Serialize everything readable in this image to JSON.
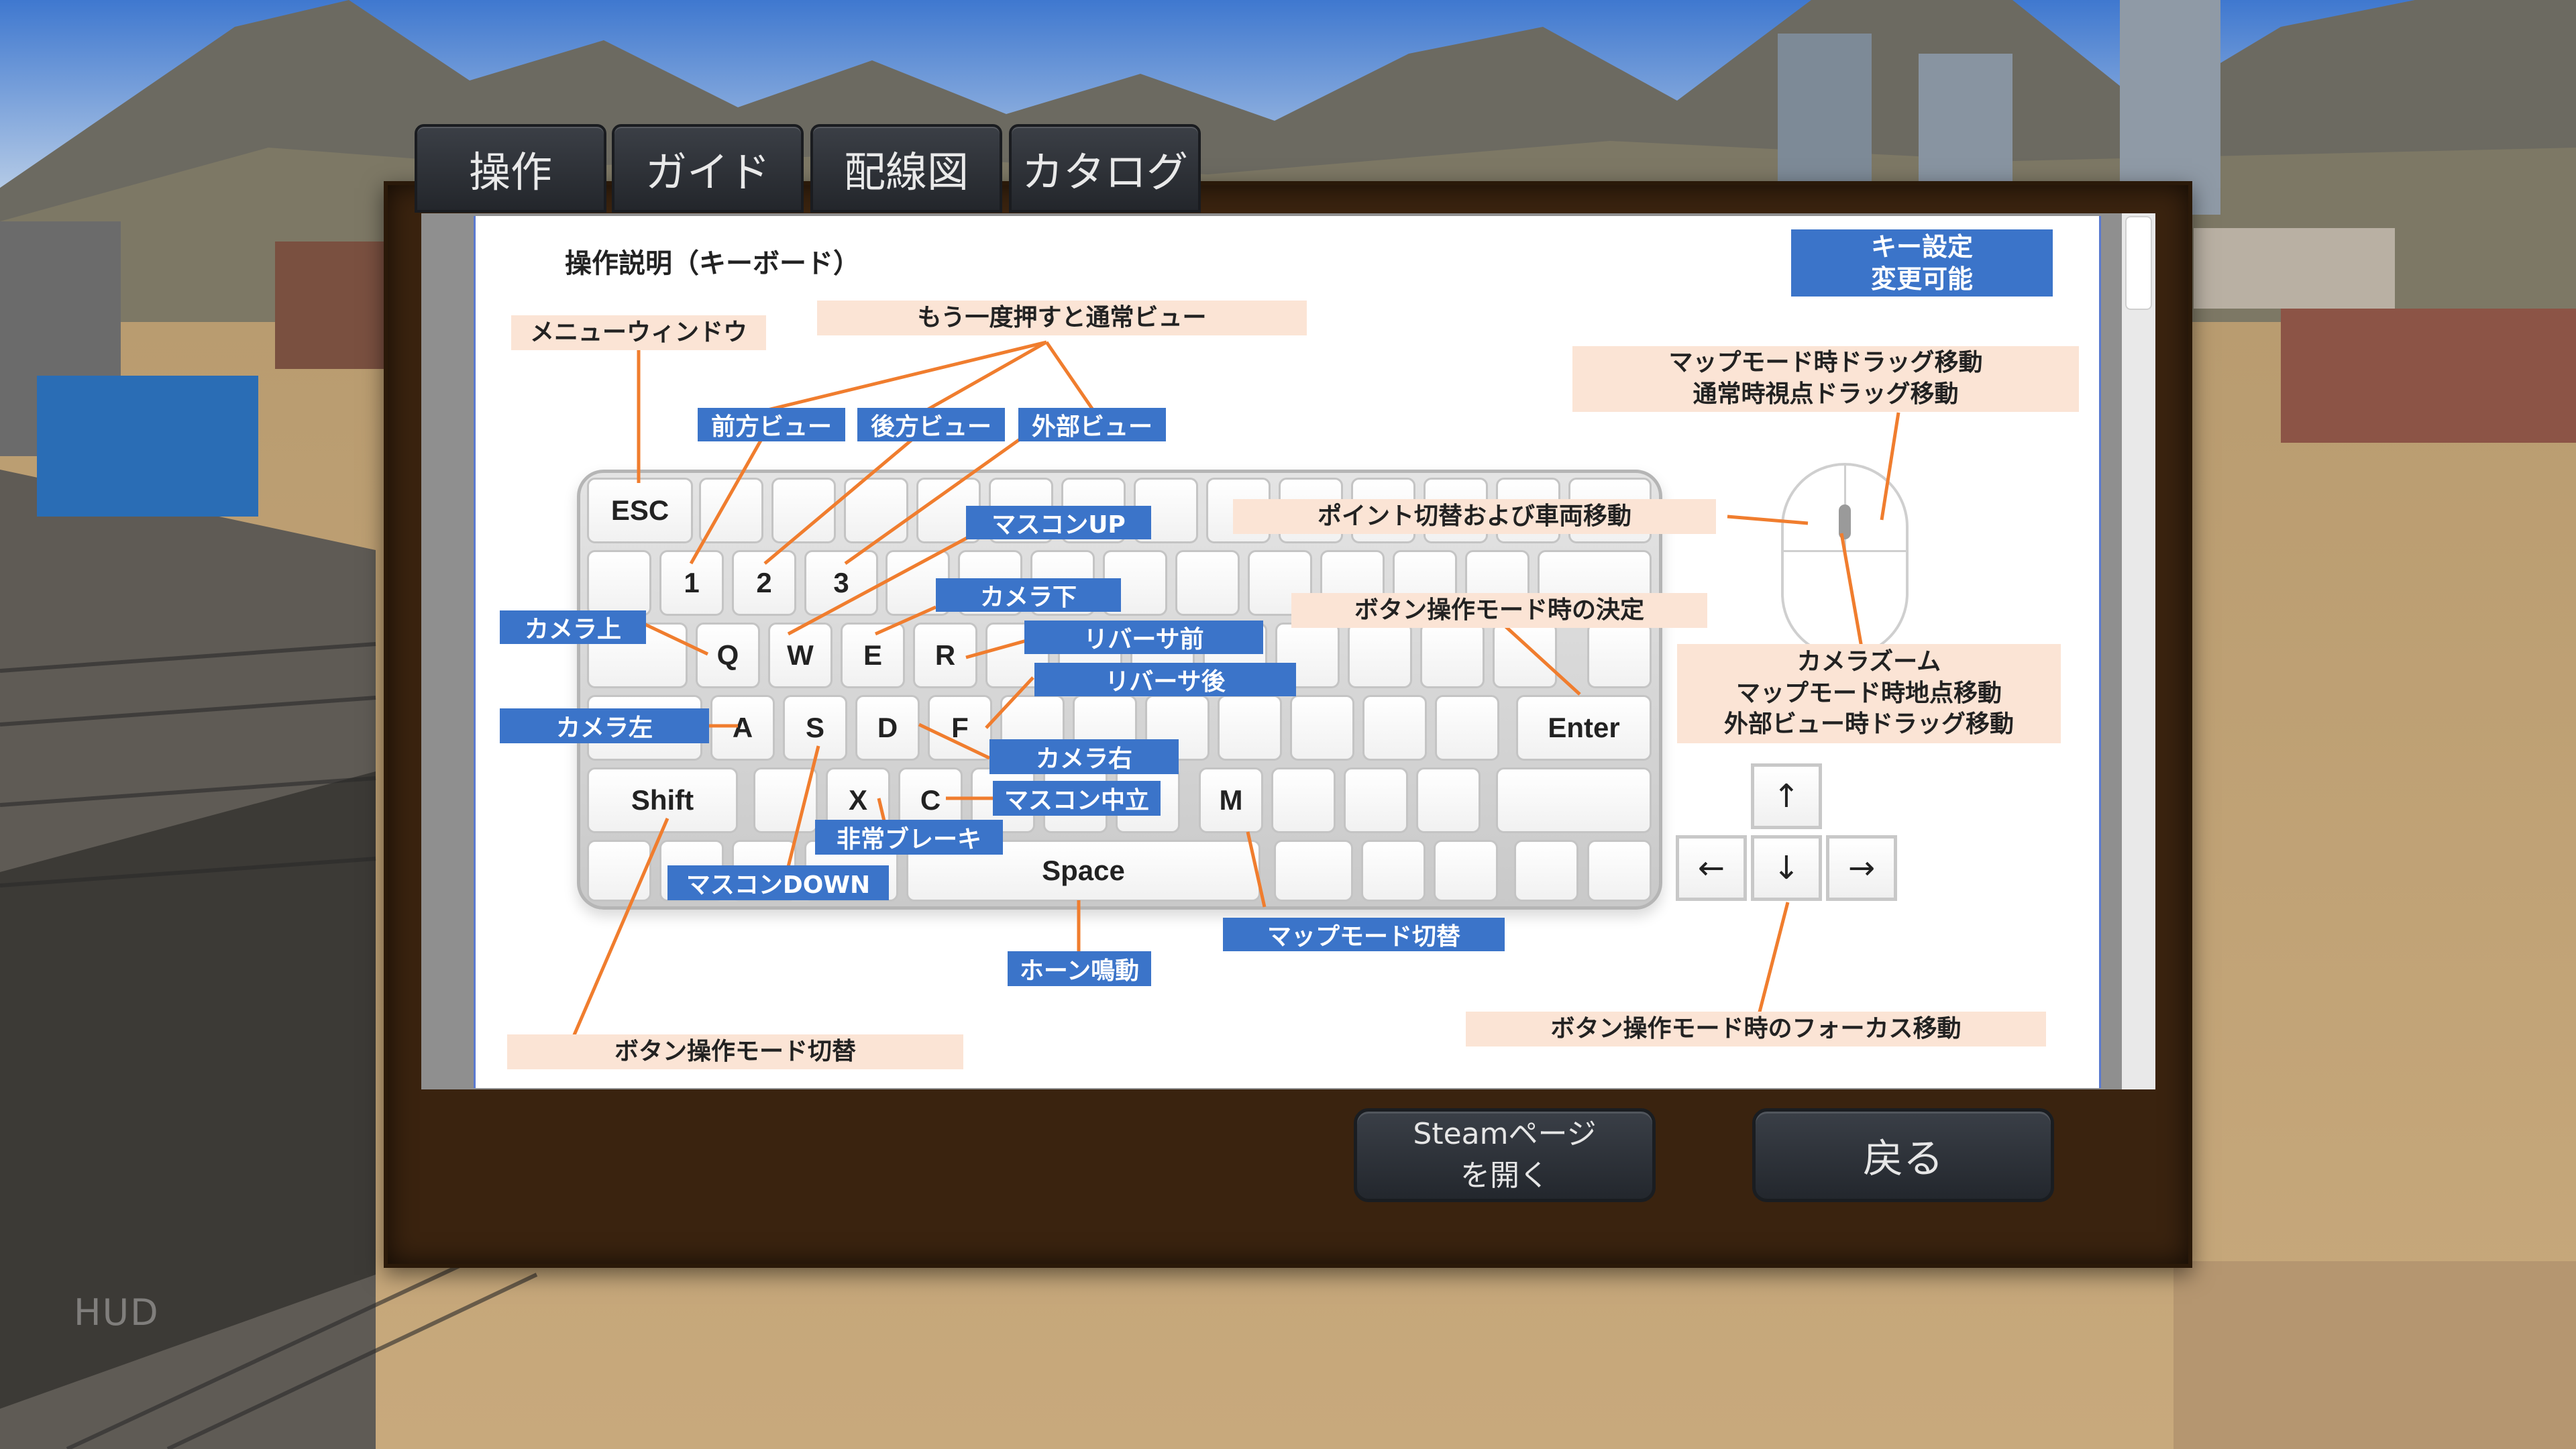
{
  "tabs": [
    "操作",
    "ガイド",
    "配線図",
    "カタログ"
  ],
  "hud_label": "HUD",
  "page_title": "操作説明（キーボード）",
  "key_setting": {
    "line1": "キー設定",
    "line2": "変更可能"
  },
  "keys": {
    "esc": "ESC",
    "n1": "1",
    "n2": "2",
    "n3": "3",
    "q": "Q",
    "w": "W",
    "e": "E",
    "r": "R",
    "a": "A",
    "s": "S",
    "d": "D",
    "f": "F",
    "shift": "Shift",
    "x": "X",
    "c": "C",
    "m": "M",
    "space": "Space",
    "enter": "Enter"
  },
  "labels": {
    "menu_window": "メニューウィンドウ",
    "normal_view": "もう一度押すと通常ビュー",
    "front_view": "前方ビュー",
    "rear_view": "後方ビュー",
    "outer_view": "外部ビュー",
    "mascon_up": "マスコンUP",
    "camera_down": "カメラ下",
    "camera_up": "カメラ上",
    "reverser_fwd": "リバーサ前",
    "reverser_back": "リバーサ後",
    "camera_left": "カメラ左",
    "camera_right": "カメラ右",
    "mascon_neutral": "マスコン中立",
    "emergency_brake": "非常ブレーキ",
    "mascon_down": "マスコンDOWN",
    "horn": "ホーン鳴動",
    "map_mode_toggle": "マップモード切替",
    "button_mode_toggle": "ボタン操作モード切替",
    "button_mode_confirm": "ボタン操作モード時の決定",
    "point_switch": "ポイント切替および車両移動",
    "mouse_drag_1": "マップモード時ドラッグ移動",
    "mouse_drag_2": "通常時視点ドラッグ移動",
    "zoom_1": "カメラズーム",
    "zoom_2": "マップモード時地点移動",
    "zoom_3": "外部ビュー時ドラッグ移動",
    "focus_move": "ボタン操作モード時のフォーカス移動"
  },
  "arrows": {
    "up": "↑",
    "left": "←",
    "down": "↓",
    "right": "→"
  },
  "buttons": {
    "steam_line1": "Steamページ",
    "steam_line2": "を開く",
    "back": "戻る"
  },
  "colors": {
    "label_blue": "#3b74c9",
    "label_peach": "#fbe4d5",
    "leader_line": "#f07d2e",
    "panel_wood": "#3a230f"
  }
}
